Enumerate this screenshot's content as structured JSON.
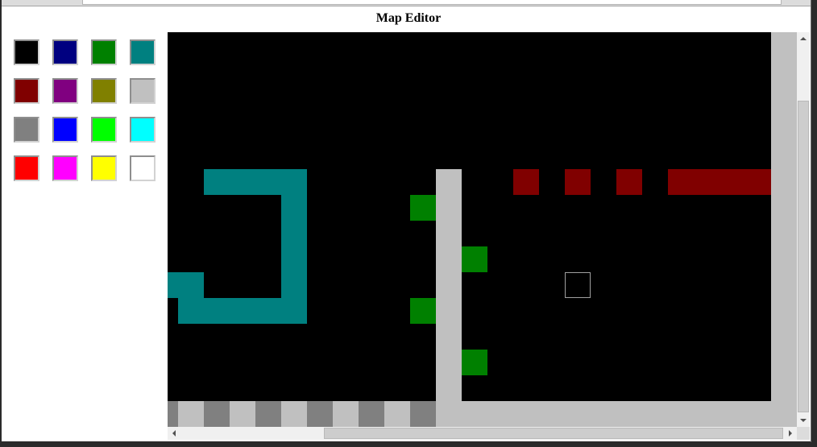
{
  "app": {
    "title": "Map Editor"
  },
  "palette": [
    "#000000",
    "#000080",
    "#008000",
    "#008080",
    "#800000",
    "#800080",
    "#808000",
    "#C0C0C0",
    "#808080",
    "#0000FF",
    "#00FF00",
    "#00FFFF",
    "#FF0000",
    "#FF00FF",
    "#FFFF00",
    "#FFFFFF"
  ],
  "map": {
    "tiles": [
      [
        0,
        0,
        0,
        0,
        0,
        0,
        0,
        0,
        0,
        0,
        0,
        0,
        0,
        0,
        0,
        0,
        0,
        0,
        0,
        0,
        0,
        0,
        0,
        0,
        7
      ],
      [
        0,
        0,
        0,
        0,
        0,
        0,
        0,
        0,
        0,
        0,
        0,
        0,
        0,
        0,
        0,
        0,
        0,
        0,
        0,
        0,
        0,
        0,
        0,
        0,
        7
      ],
      [
        0,
        0,
        0,
        0,
        0,
        0,
        0,
        0,
        0,
        0,
        0,
        0,
        0,
        0,
        0,
        0,
        0,
        0,
        0,
        0,
        0,
        0,
        0,
        0,
        7
      ],
      [
        0,
        0,
        0,
        0,
        0,
        0,
        0,
        0,
        0,
        0,
        0,
        0,
        0,
        0,
        0,
        0,
        0,
        0,
        0,
        0,
        0,
        0,
        0,
        0,
        7
      ],
      [
        0,
        0,
        0,
        0,
        0,
        0,
        0,
        0,
        0,
        0,
        0,
        0,
        0,
        0,
        0,
        0,
        0,
        0,
        0,
        0,
        0,
        0,
        0,
        0,
        7
      ],
      [
        0,
        0,
        0,
        0,
        0,
        0,
        0,
        0,
        0,
        0,
        0,
        0,
        0,
        0,
        0,
        0,
        0,
        0,
        0,
        0,
        0,
        0,
        0,
        0,
        7
      ],
      [
        0,
        0,
        3,
        3,
        3,
        3,
        0,
        0,
        0,
        0,
        0,
        7,
        0,
        0,
        4,
        0,
        4,
        0,
        4,
        0,
        4,
        4,
        4,
        4,
        7
      ],
      [
        0,
        0,
        0,
        0,
        0,
        3,
        0,
        0,
        0,
        0,
        2,
        7,
        0,
        0,
        0,
        0,
        0,
        0,
        0,
        0,
        0,
        0,
        0,
        0,
        7
      ],
      [
        0,
        0,
        0,
        0,
        0,
        3,
        0,
        0,
        0,
        0,
        0,
        7,
        0,
        0,
        0,
        0,
        0,
        0,
        0,
        0,
        0,
        0,
        0,
        0,
        7
      ],
      [
        0,
        0,
        0,
        0,
        0,
        3,
        0,
        0,
        0,
        0,
        0,
        7,
        2,
        0,
        0,
        0,
        0,
        0,
        0,
        0,
        0,
        0,
        0,
        0,
        7
      ],
      [
        3,
        3,
        0,
        0,
        0,
        3,
        0,
        0,
        0,
        0,
        0,
        7,
        0,
        0,
        0,
        0,
        0,
        0,
        0,
        0,
        0,
        0,
        0,
        0,
        7
      ],
      [
        0,
        3,
        3,
        3,
        3,
        3,
        0,
        0,
        0,
        0,
        2,
        7,
        0,
        0,
        0,
        0,
        0,
        0,
        0,
        0,
        0,
        0,
        0,
        0,
        7
      ],
      [
        0,
        0,
        0,
        0,
        0,
        0,
        0,
        0,
        0,
        0,
        0,
        7,
        0,
        0,
        0,
        0,
        0,
        0,
        0,
        0,
        0,
        0,
        0,
        0,
        7
      ],
      [
        0,
        0,
        0,
        0,
        0,
        0,
        0,
        0,
        0,
        0,
        0,
        7,
        2,
        0,
        0,
        0,
        0,
        0,
        0,
        0,
        0,
        0,
        0,
        0,
        7
      ],
      [
        0,
        0,
        0,
        0,
        0,
        0,
        0,
        0,
        0,
        0,
        0,
        7,
        0,
        0,
        0,
        0,
        0,
        0,
        0,
        0,
        0,
        0,
        0,
        0,
        7
      ],
      [
        8,
        7,
        8,
        7,
        8,
        7,
        8,
        7,
        8,
        7,
        8,
        7,
        7,
        7,
        7,
        7,
        7,
        7,
        7,
        7,
        7,
        7,
        7,
        7,
        7
      ]
    ]
  }
}
